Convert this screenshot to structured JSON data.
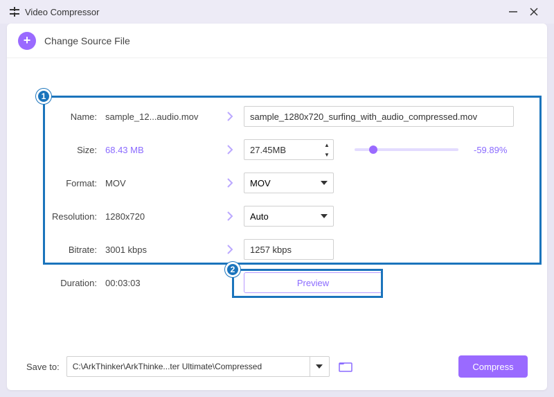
{
  "title": "Video Compressor",
  "header": {
    "change_source": "Change Source File"
  },
  "callouts": {
    "one": "1",
    "two": "2"
  },
  "labels": {
    "name": "Name:",
    "size": "Size:",
    "format": "Format:",
    "resolution": "Resolution:",
    "bitrate": "Bitrate:",
    "duration": "Duration:"
  },
  "source": {
    "name": "sample_12...audio.mov",
    "size": "68.43 MB",
    "format": "MOV",
    "resolution": "1280x720",
    "bitrate": "3001 kbps",
    "duration": "00:03:03"
  },
  "target": {
    "name": "sample_1280x720_surfing_with_audio_compressed.mov",
    "size": "27.45MB",
    "format": "MOV",
    "resolution": "Auto",
    "bitrate": "1257 kbps"
  },
  "size_percent": "-59.89%",
  "preview_label": "Preview",
  "footer": {
    "save_to": "Save to:",
    "path": "C:\\ArkThinker\\ArkThinke...ter Ultimate\\Compressed",
    "compress": "Compress"
  }
}
